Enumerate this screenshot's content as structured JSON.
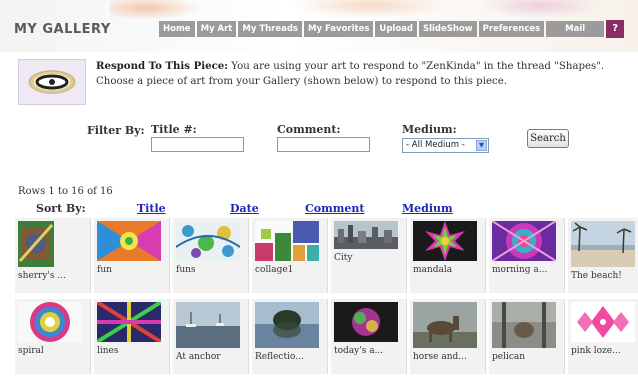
{
  "header": {
    "logo": "MY GALLERY",
    "nav": [
      "Home",
      "My Art",
      "My Threads",
      "My Favorites",
      "Upload",
      "SlideShow",
      "Preferences",
      "Mail"
    ],
    "help_label": "?"
  },
  "respond": {
    "heading": "Respond To This Piece:",
    "text": "You are using your art to respond to \"ZenKinda\" in the thread \"Shapes\". Choose a piece of art from your Gallery (shown below) to respond to this piece."
  },
  "filter": {
    "label": "Filter By:",
    "title_label": "Title #:",
    "comment_label": "Comment:",
    "medium_label": "Medium:",
    "medium_selected": "- All Medium -",
    "title_value": "",
    "comment_value": "",
    "search_label": "Search"
  },
  "list": {
    "rows_info": "Rows 1 to 16 of 16",
    "sort_label": "Sort By:",
    "sort_links": [
      "Title",
      "Date",
      "Comment",
      "Medium"
    ]
  },
  "gallery": {
    "items": [
      {
        "title": "sherry's ...",
        "thumb": "sherry-thumb"
      },
      {
        "title": "fun",
        "thumb": "fun-thumb"
      },
      {
        "title": "funs",
        "thumb": "funs-thumb"
      },
      {
        "title": "collage1",
        "thumb": "collage-thumb"
      },
      {
        "title": "City",
        "thumb": "city-thumb"
      },
      {
        "title": "mandala",
        "thumb": "mandala-thumb"
      },
      {
        "title": "morning a...",
        "thumb": "morning-thumb"
      },
      {
        "title": "The beach!",
        "thumb": "beach-thumb"
      },
      {
        "title": "spiral",
        "thumb": "spiral-thumb"
      },
      {
        "title": "lines",
        "thumb": "lines-thumb"
      },
      {
        "title": "At anchor",
        "thumb": "anchor-thumb"
      },
      {
        "title": "Reflectio...",
        "thumb": "reflection-thumb"
      },
      {
        "title": "today's a...",
        "thumb": "today-thumb"
      },
      {
        "title": "horse and...",
        "thumb": "horse-thumb"
      },
      {
        "title": "pelican",
        "thumb": "pelican-thumb"
      },
      {
        "title": "pink loze...",
        "thumb": "pink-thumb"
      }
    ]
  },
  "colors": {
    "nav_bg": "#9b9b9b",
    "help_bg": "#8b2d62",
    "link": "#1d26b5",
    "cell_bg": "#f2f2f2"
  }
}
